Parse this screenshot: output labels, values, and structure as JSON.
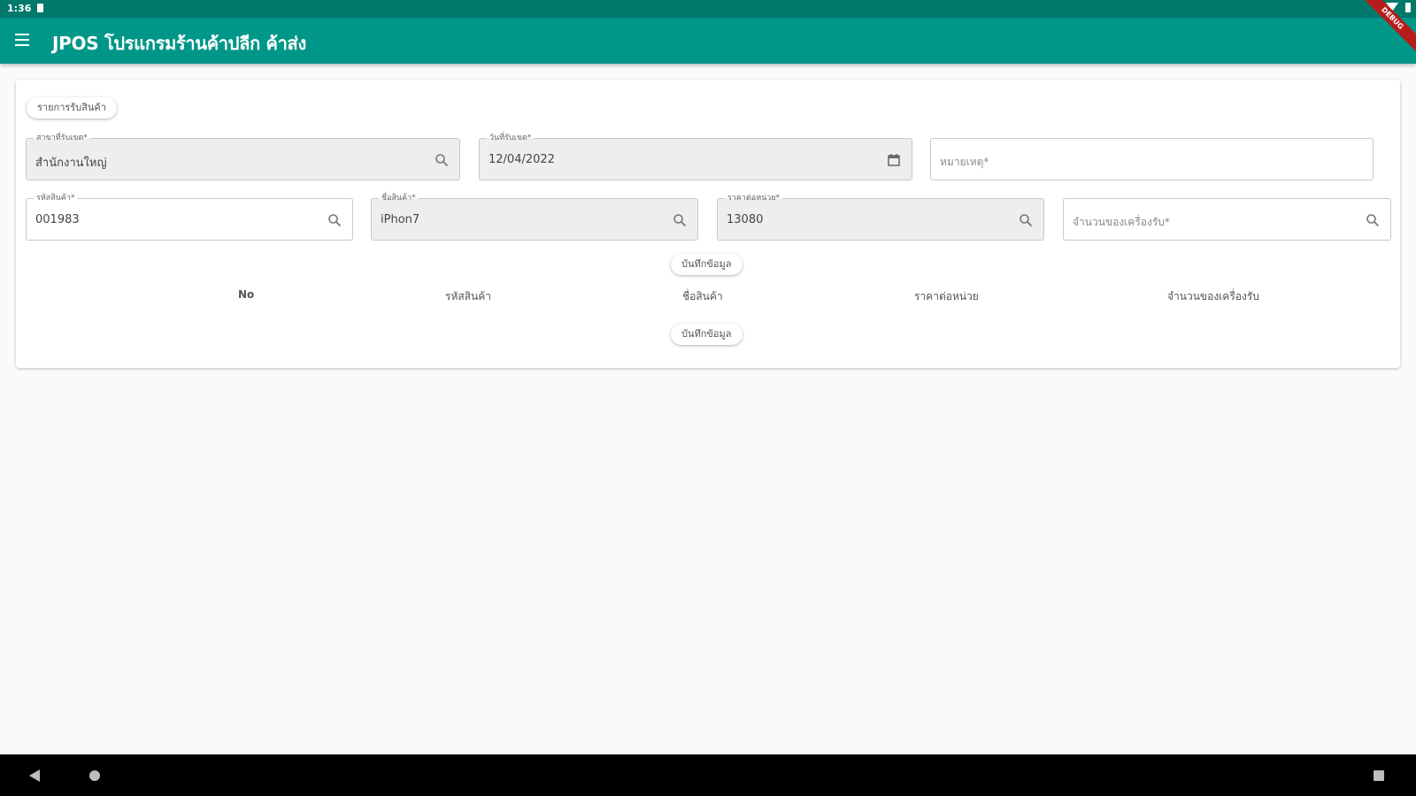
{
  "status_bar": {
    "time": "1:36"
  },
  "debug_banner": "DEBUG",
  "app_bar": {
    "title": "JPOS โปรแกรมร้านค้าปลีก ค้าส่ง"
  },
  "form": {
    "top_button": "รายการรับสินค้า",
    "branch": {
      "label": "สาขาที่รับเขต*",
      "value": "สำนักงานใหญ่",
      "icon": "search-icon"
    },
    "date": {
      "label": "วันที่รับเขต*",
      "value": "12/04/2022",
      "icon": "calendar-icon"
    },
    "note": {
      "placeholder": "หมายเหตุ*"
    },
    "product_code": {
      "label": "รหัสสินค้า*",
      "value": "001983",
      "icon": "search-icon"
    },
    "product_name": {
      "label": "ชื่อสินค้า*",
      "value": "iPhon7",
      "icon": "search-icon"
    },
    "price": {
      "label": "ราคาต่อหน่วย*",
      "value": "13080",
      "icon": "search-icon"
    },
    "quantity": {
      "placeholder": "จำนวนของเครื่องรับ*",
      "icon": "search-icon"
    },
    "save_button": "บันทึกข้อมูล"
  },
  "table": {
    "headers": [
      "No",
      "รหัสสินค้า",
      "ชื่อสินค้า",
      "ราคาต่อหน่วย",
      "จำนวนของเครื่องรับ"
    ]
  },
  "bottom_button": "บันทึกข้อมูล",
  "colors": {
    "status_bar": "#00796b",
    "app_bar": "#009688",
    "background": "#fafafa"
  }
}
